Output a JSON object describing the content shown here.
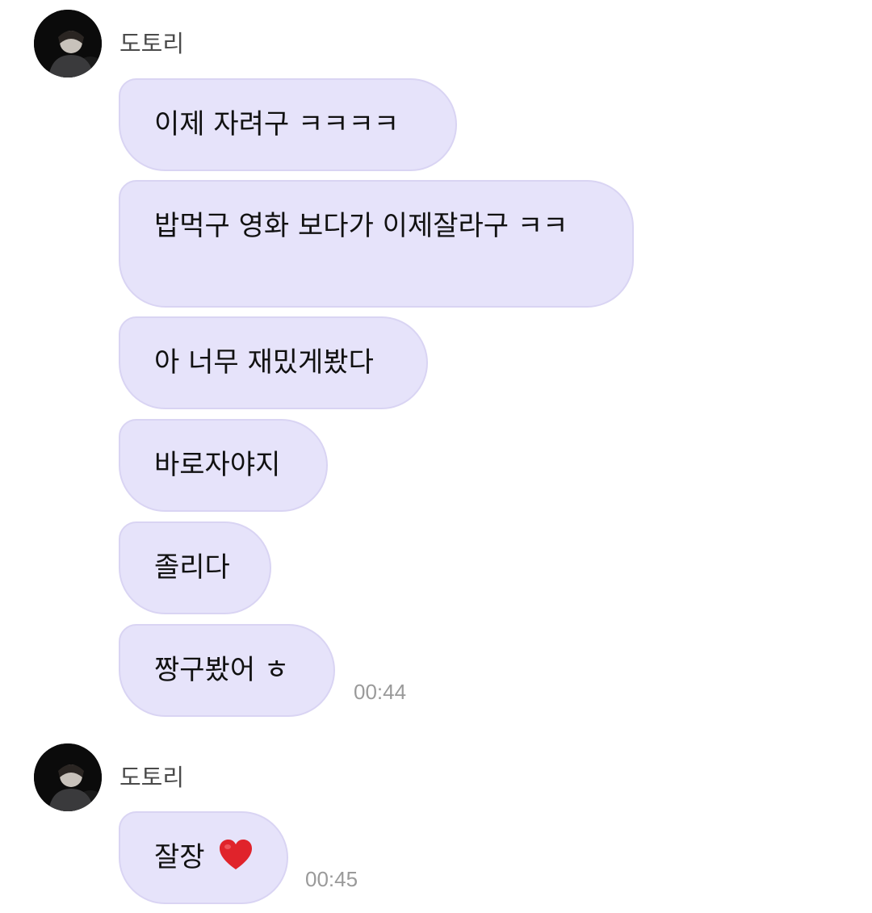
{
  "groups": [
    {
      "sender": "도토리",
      "messages": [
        "이제 자려구 ㅋㅋㅋㅋ",
        "밥먹구 영화 보다가 이제잘라구 ㅋㅋ",
        "아 너무 재밌게봤다",
        "바로자야지",
        "졸리다",
        "짱구봤어 ㅎ"
      ],
      "time": "00:44"
    },
    {
      "sender": "도토리",
      "messages": [
        "잘장"
      ],
      "time": "00:45",
      "emoji_icon": "red-heart-icon"
    }
  ]
}
